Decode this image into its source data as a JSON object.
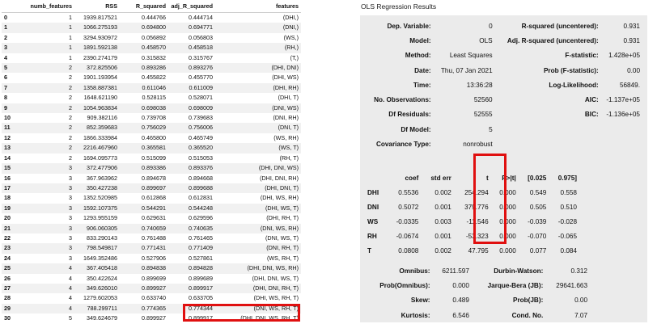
{
  "left": {
    "headers": [
      "",
      "numb_features",
      "RSS",
      "R_squared",
      "adj_R_squared",
      "features"
    ],
    "rows": [
      [
        "0",
        "1",
        "1939.817521",
        "0.444766",
        "0.444714",
        "(DHI,)"
      ],
      [
        "1",
        "1",
        "1066.275193",
        "0.694800",
        "0.694771",
        "(DNI,)"
      ],
      [
        "2",
        "1",
        "3294.930972",
        "0.056892",
        "0.056803",
        "(WS,)"
      ],
      [
        "3",
        "1",
        "1891.592138",
        "0.458570",
        "0.458518",
        "(RH,)"
      ],
      [
        "4",
        "1",
        "2390.274179",
        "0.315832",
        "0.315767",
        "(T,)"
      ],
      [
        "5",
        "2",
        "372.825506",
        "0.893286",
        "0.893276",
        "(DHI, DNI)"
      ],
      [
        "6",
        "2",
        "1901.193954",
        "0.455822",
        "0.455770",
        "(DHI, WS)"
      ],
      [
        "7",
        "2",
        "1358.887381",
        "0.611046",
        "0.611009",
        "(DHI, RH)"
      ],
      [
        "8",
        "2",
        "1648.621190",
        "0.528115",
        "0.528071",
        "(DHI, T)"
      ],
      [
        "9",
        "2",
        "1054.963834",
        "0.698038",
        "0.698009",
        "(DNI, WS)"
      ],
      [
        "10",
        "2",
        "909.382116",
        "0.739708",
        "0.739683",
        "(DNI, RH)"
      ],
      [
        "11",
        "2",
        "852.359683",
        "0.756029",
        "0.756006",
        "(DNI, T)"
      ],
      [
        "12",
        "2",
        "1866.333984",
        "0.465800",
        "0.465749",
        "(WS, RH)"
      ],
      [
        "13",
        "2",
        "2216.467960",
        "0.365581",
        "0.365520",
        "(WS, T)"
      ],
      [
        "14",
        "2",
        "1694.095773",
        "0.515099",
        "0.515053",
        "(RH, T)"
      ],
      [
        "15",
        "3",
        "372.477906",
        "0.893386",
        "0.893376",
        "(DHI, DNI, WS)"
      ],
      [
        "16",
        "3",
        "367.963962",
        "0.894678",
        "0.894668",
        "(DHI, DNI, RH)"
      ],
      [
        "17",
        "3",
        "350.427238",
        "0.899697",
        "0.899688",
        "(DHI, DNI, T)"
      ],
      [
        "18",
        "3",
        "1352.520985",
        "0.612868",
        "0.612831",
        "(DHI, WS, RH)"
      ],
      [
        "19",
        "3",
        "1592.107375",
        "0.544291",
        "0.544248",
        "(DHI, WS, T)"
      ],
      [
        "20",
        "3",
        "1293.955159",
        "0.629631",
        "0.629596",
        "(DHI, RH, T)"
      ],
      [
        "21",
        "3",
        "906.060305",
        "0.740659",
        "0.740635",
        "(DNI, WS, RH)"
      ],
      [
        "22",
        "3",
        "833.290143",
        "0.761488",
        "0.761465",
        "(DNI, WS, T)"
      ],
      [
        "23",
        "3",
        "798.549817",
        "0.771431",
        "0.771409",
        "(DNI, RH, T)"
      ],
      [
        "24",
        "3",
        "1649.352486",
        "0.527906",
        "0.527861",
        "(WS, RH, T)"
      ],
      [
        "25",
        "4",
        "367.405418",
        "0.894838",
        "0.894828",
        "(DHI, DNI, WS, RH)"
      ],
      [
        "26",
        "4",
        "350.422624",
        "0.899699",
        "0.899689",
        "(DHI, DNI, WS, T)"
      ],
      [
        "27",
        "4",
        "349.626010",
        "0.899927",
        "0.899917",
        "(DHI, DNI, RH, T)"
      ],
      [
        "28",
        "4",
        "1279.602053",
        "0.633740",
        "0.633705",
        "(DHI, WS, RH, T)"
      ],
      [
        "29",
        "4",
        "788.299711",
        "0.774365",
        "0.774344",
        "(DNI, WS, RH, T)"
      ],
      [
        "30",
        "5",
        "349.624679",
        "0.899927",
        "0.899917",
        "(DHI, DNI, WS, RH, T)"
      ]
    ]
  },
  "right": {
    "title": "OLS Regression Results",
    "summary": [
      [
        "Dep. Variable:",
        "0",
        "R-squared (uncentered):",
        "0.931"
      ],
      [
        "Model:",
        "OLS",
        "Adj. R-squared (uncentered):",
        "0.931"
      ],
      [
        "Method:",
        "Least Squares",
        "F-statistic:",
        "1.428e+05"
      ],
      [
        "Date:",
        "Thu, 07 Jan 2021",
        "Prob (F-statistic):",
        "0.00"
      ],
      [
        "Time:",
        "13:36:28",
        "Log-Likelihood:",
        "56849."
      ],
      [
        "No. Observations:",
        "52560",
        "AIC:",
        "-1.137e+05"
      ],
      [
        "Df Residuals:",
        "52555",
        "BIC:",
        "-1.136e+05"
      ],
      [
        "Df Model:",
        "5",
        "",
        ""
      ],
      [
        "Covariance Type:",
        "nonrobust",
        "",
        ""
      ]
    ],
    "coef_headers": [
      "",
      "coef",
      "std err",
      "t",
      "P>|t|",
      "[0.025",
      "0.975]"
    ],
    "coef_rows": [
      [
        "DHI",
        "0.5536",
        "0.002",
        "254.294",
        "0.000",
        "0.549",
        "0.558"
      ],
      [
        "DNI",
        "0.5072",
        "0.001",
        "379.776",
        "0.000",
        "0.505",
        "0.510"
      ],
      [
        "WS",
        "-0.0335",
        "0.003",
        "-11.546",
        "0.000",
        "-0.039",
        "-0.028"
      ],
      [
        "RH",
        "-0.0674",
        "0.001",
        "-53.323",
        "0.000",
        "-0.070",
        "-0.065"
      ],
      [
        "T",
        "0.0808",
        "0.002",
        "47.795",
        "0.000",
        "0.077",
        "0.084"
      ]
    ],
    "diagnostics": [
      [
        "Omnibus:",
        "6211.597",
        "Durbin-Watson:",
        "0.312"
      ],
      [
        "Prob(Omnibus):",
        "0.000",
        "Jarque-Bera (JB):",
        "29641.663"
      ],
      [
        "Skew:",
        "0.489",
        "Prob(JB):",
        "0.00"
      ],
      [
        "Kurtosis:",
        "6.546",
        "Cond. No.",
        "7.07"
      ]
    ]
  },
  "colors": {
    "highlight": "#e01010",
    "panel_bg": "#ebebeb",
    "row_stripe": "#f1f1f1"
  }
}
